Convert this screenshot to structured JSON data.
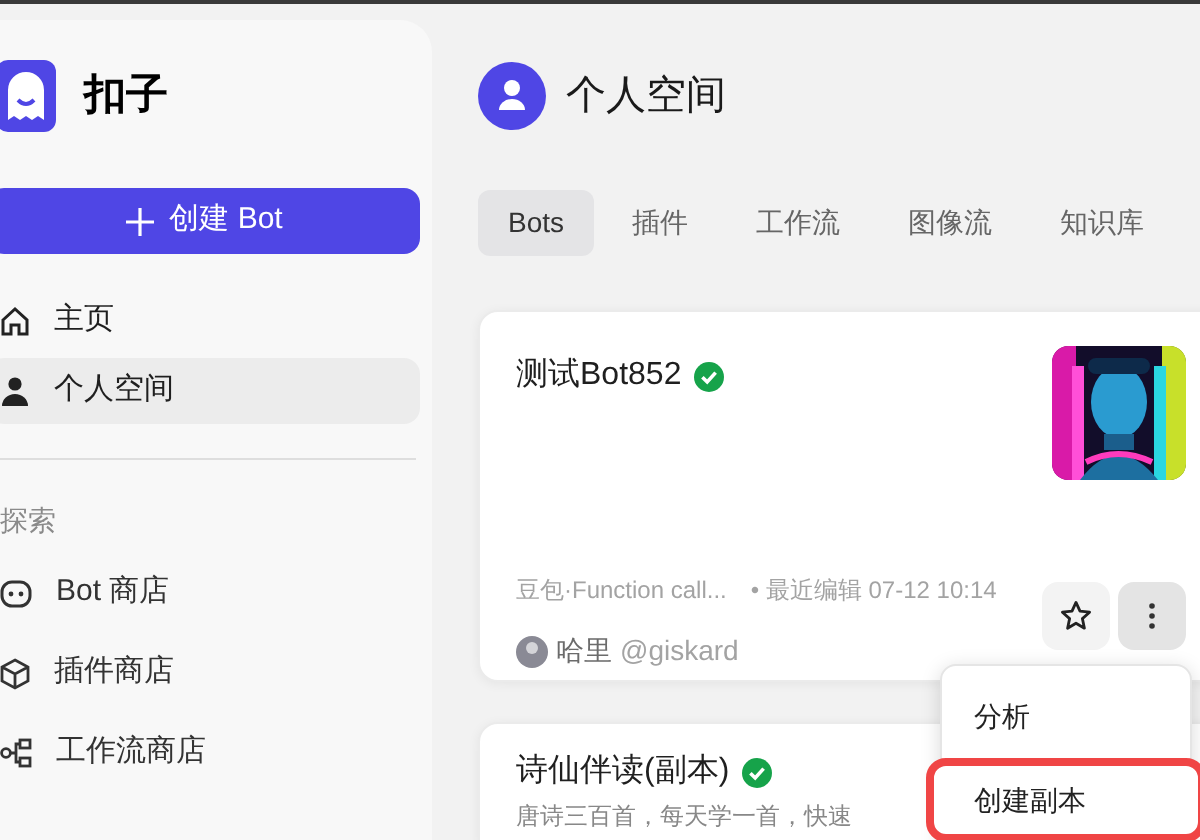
{
  "app": {
    "name": "扣子"
  },
  "create_button": {
    "label": "创建 Bot"
  },
  "nav": [
    {
      "label": "主页",
      "selected": false
    },
    {
      "label": "个人空间",
      "selected": true
    }
  ],
  "explore": {
    "heading": "探索",
    "items": [
      {
        "label": "Bot 商店"
      },
      {
        "label": "插件商店"
      },
      {
        "label": "工作流商店"
      }
    ]
  },
  "page": {
    "title": "个人空间"
  },
  "tabs": [
    {
      "label": "Bots",
      "selected": true
    },
    {
      "label": "插件",
      "selected": false
    },
    {
      "label": "工作流",
      "selected": false
    },
    {
      "label": "图像流",
      "selected": false
    },
    {
      "label": "知识库",
      "selected": false
    }
  ],
  "cards": [
    {
      "title": "测试Bot852",
      "verified": true,
      "model": "豆包·Function call...",
      "edited": "• 最近编辑 07-12 10:14",
      "author": "哈里",
      "handle": "@giskard",
      "kind": "full"
    },
    {
      "title": "诗仙伴读(副本)",
      "verified": true,
      "description": "唐诗三百首，每天学一首，快速",
      "kind": "partial"
    }
  ],
  "menu": {
    "items": [
      {
        "label": "分析",
        "highlighted": false
      },
      {
        "label": "创建副本",
        "highlighted": true
      }
    ]
  }
}
